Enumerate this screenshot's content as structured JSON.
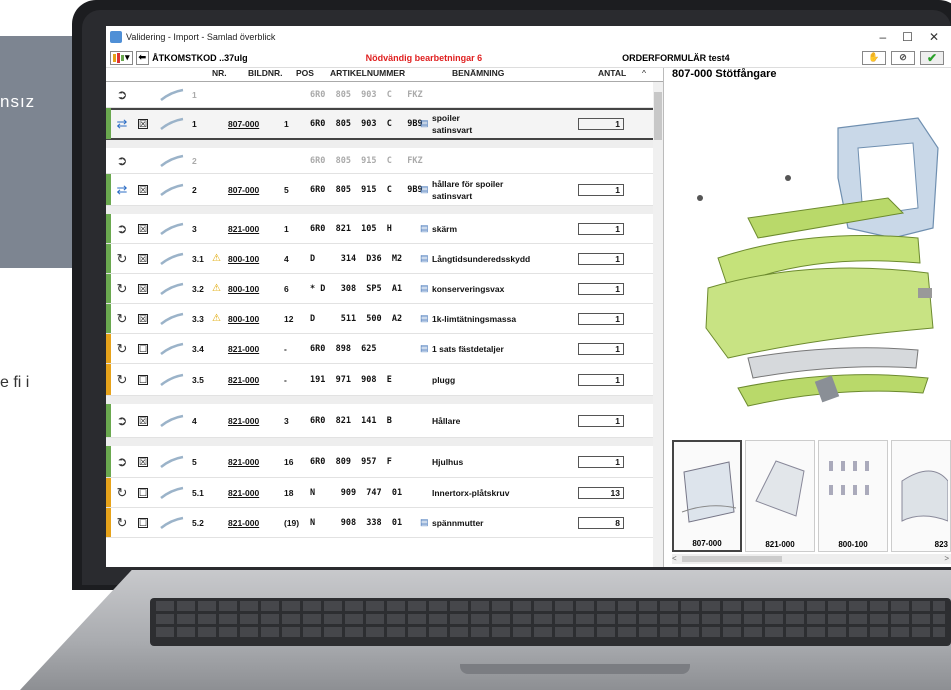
{
  "background": {
    "text1": "nsız",
    "text2": "e fi i"
  },
  "window": {
    "title": "Validering - Import - Samlad överblick",
    "controls": [
      "–",
      "☐",
      "✕"
    ]
  },
  "toolbar": {
    "access_code": "ÅTKOMSTKOD ..37ulg",
    "warning": "Nödvändig bearbetningar 6",
    "order": "ORDERFORMULÄR test4"
  },
  "table": {
    "headers": [
      "NR.",
      "BILDNR.",
      "POS",
      "ARTIKELNUMMER",
      "BENÄMNING",
      "ANTAL"
    ],
    "rows": [
      {
        "kind": "gray",
        "strip": "",
        "action": "arrow-right-circle",
        "check": "",
        "nr": "1",
        "warn": false,
        "bild": "",
        "pos": "",
        "art": "6R0  805  903  C   FKZ",
        "info": false,
        "ben": "",
        "ben2": "",
        "ant": "",
        "h": 26
      },
      {
        "kind": "sel",
        "strip": "#6aa84f",
        "action": "swap-arrows",
        "check": "☒",
        "nr": "1",
        "warn": false,
        "bild": "807-000",
        "pos": "1",
        "art": "6R0  805  903  C   9B9",
        "info": true,
        "ben": "spoiler",
        "ben2": "satinsvart",
        "ant": "1",
        "h": 32
      },
      {
        "kind": "gap",
        "h": 8
      },
      {
        "kind": "gray",
        "strip": "",
        "action": "arrow-right-circle",
        "check": "",
        "nr": "2",
        "warn": false,
        "bild": "",
        "pos": "",
        "art": "6R0  805  915  C   FKZ",
        "info": false,
        "ben": "",
        "ben2": "",
        "ant": "",
        "h": 26
      },
      {
        "kind": "",
        "strip": "#6aa84f",
        "action": "swap-arrows",
        "check": "☒",
        "nr": "2",
        "warn": false,
        "bild": "807-000",
        "pos": "5",
        "art": "6R0  805  915  C   9B9",
        "info": true,
        "ben": "hållare för spoiler",
        "ben2": "satinsvart",
        "ant": "1",
        "h": 32
      },
      {
        "kind": "gap",
        "h": 8
      },
      {
        "kind": "",
        "strip": "#6aa84f",
        "action": "arrow-right-circle",
        "check": "☒",
        "nr": "3",
        "warn": false,
        "bild": "821-000",
        "pos": "1",
        "art": "6R0  821  105  H",
        "info": true,
        "ben": "skärm",
        "ben2": "",
        "ant": "1",
        "h": 30
      },
      {
        "kind": "",
        "strip": "#6aa84f",
        "action": "refresh-gear",
        "check": "☒",
        "nr": "3.1",
        "warn": true,
        "bild": "800-100",
        "pos": "4",
        "art": "D     314  D36  M2",
        "info": true,
        "ben": "Långtidsunderedsskydd",
        "ben2": "",
        "ant": "1",
        "h": 30
      },
      {
        "kind": "",
        "strip": "#6aa84f",
        "action": "refresh-gear",
        "check": "☒",
        "nr": "3.2",
        "warn": true,
        "bild": "800-100",
        "pos": "6",
        "art": "* D   308  SP5  A1",
        "info": true,
        "ben": "konserveringsvax",
        "ben2": "",
        "ant": "1",
        "h": 30
      },
      {
        "kind": "",
        "strip": "#6aa84f",
        "action": "refresh-gear",
        "check": "☒",
        "nr": "3.3",
        "warn": true,
        "bild": "800-100",
        "pos": "12",
        "art": "D     511  500  A2",
        "info": true,
        "ben": "1k-limtätningsmassa",
        "ben2": "",
        "ant": "1",
        "h": 30
      },
      {
        "kind": "",
        "strip": "#e6a21a",
        "action": "refresh-gear",
        "check": "☐",
        "nr": "3.4",
        "warn": false,
        "bild": "821-000",
        "pos": "-",
        "art": "6R0  898  625",
        "info": true,
        "ben": "1 sats fästdetaljer",
        "ben2": "",
        "ant": "1",
        "h": 30
      },
      {
        "kind": "",
        "strip": "#e6a21a",
        "action": "refresh-gear",
        "check": "☐",
        "nr": "3.5",
        "warn": false,
        "bild": "821-000",
        "pos": "-",
        "art": "191  971  908  E",
        "info": false,
        "ben": "plugg",
        "ben2": "",
        "ant": "1",
        "h": 32
      },
      {
        "kind": "gap",
        "h": 8
      },
      {
        "kind": "",
        "strip": "#6aa84f",
        "action": "arrow-right-circle",
        "check": "☒",
        "nr": "4",
        "warn": false,
        "bild": "821-000",
        "pos": "3",
        "art": "6R0  821  141  B",
        "info": false,
        "ben": "Hållare",
        "ben2": "",
        "ant": "1",
        "h": 34
      },
      {
        "kind": "gap",
        "h": 8
      },
      {
        "kind": "",
        "strip": "#6aa84f",
        "action": "arrow-right-circle",
        "check": "☒",
        "nr": "5",
        "warn": false,
        "bild": "821-000",
        "pos": "16",
        "art": "6R0  809  957  F",
        "info": false,
        "ben": "Hjulhus",
        "ben2": "",
        "ant": "1",
        "h": 32
      },
      {
        "kind": "",
        "strip": "#e6a21a",
        "action": "refresh-gear",
        "check": "☐",
        "nr": "5.1",
        "warn": false,
        "bild": "821-000",
        "pos": "18",
        "art": "N     909  747  01",
        "info": false,
        "ben": "Innertorx-plåtskruv",
        "ben2": "",
        "ant": "13",
        "h": 30
      },
      {
        "kind": "",
        "strip": "#e6a21a",
        "action": "refresh-gear",
        "check": "☐",
        "nr": "5.2",
        "warn": false,
        "bild": "821-000",
        "pos": "(19)",
        "art": "N     908  338  01",
        "info": true,
        "ben": "spännmutter",
        "ben2": "",
        "ant": "8",
        "h": 30
      }
    ]
  },
  "panel": {
    "title": "807-000 Stötfångare",
    "thumbs": [
      "807-000",
      "821-000",
      "800-100",
      "823"
    ]
  }
}
